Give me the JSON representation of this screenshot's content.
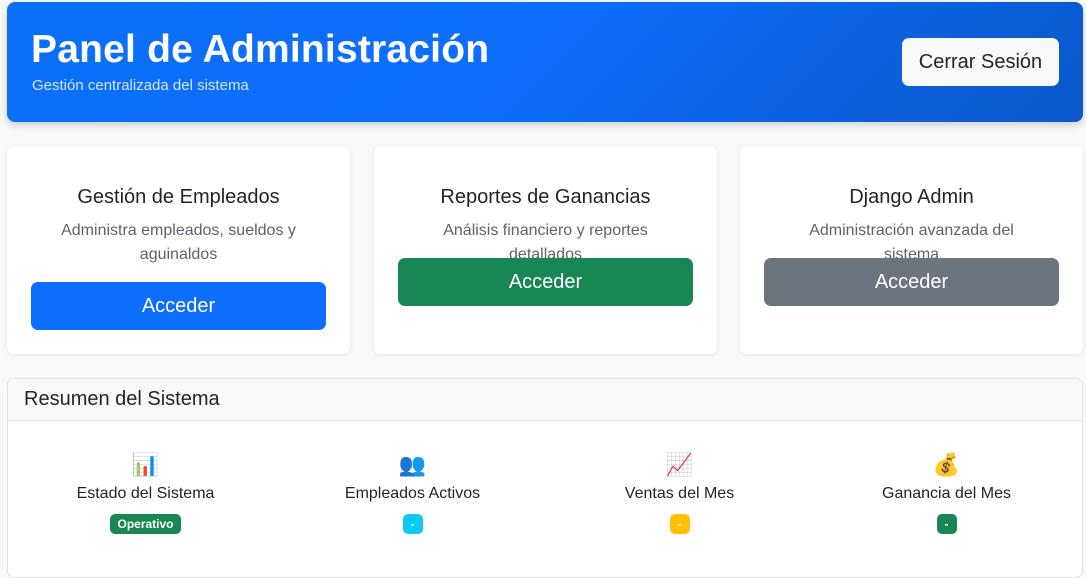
{
  "header": {
    "title": "Panel de Administración",
    "subtitle": "Gestión centralizada del sistema",
    "logout_label": "Cerrar Sesión"
  },
  "cards": [
    {
      "title": "Gestión de Empleados",
      "text": "Administra empleados, sueldos y aguinaldos",
      "button_label": "Acceder",
      "button_color": "#0d6efd"
    },
    {
      "title": "Reportes de Ganancias",
      "text": "Análisis financiero y reportes detallados",
      "button_label": "Acceder",
      "button_color": "#198754"
    },
    {
      "title": "Django Admin",
      "text": "Administración avanzada del sistema",
      "button_label": "Acceder",
      "button_color": "#6c757d"
    }
  ],
  "summary": {
    "title": "Resumen del Sistema",
    "stats": [
      {
        "icon": "bar-chart-icon",
        "glyph": "📊",
        "label": "Estado del Sistema",
        "badge": "Operativo",
        "badge_color": "#198754"
      },
      {
        "icon": "people-icon",
        "glyph": "👥",
        "label": "Empleados Activos",
        "badge": "-",
        "badge_color": "#0dcaf0"
      },
      {
        "icon": "trending-up-icon",
        "glyph": "📈",
        "label": "Ventas del Mes",
        "badge": "-",
        "badge_color": "#ffc107"
      },
      {
        "icon": "money-bag-icon",
        "glyph": "💰",
        "label": "Ganancia del Mes",
        "badge": "-",
        "badge_color": "#198754"
      }
    ]
  }
}
